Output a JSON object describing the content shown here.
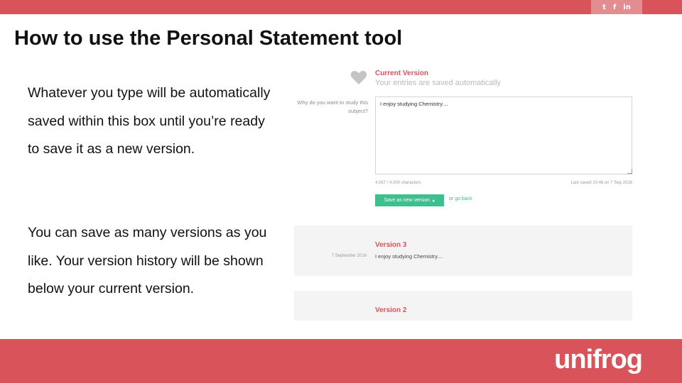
{
  "social_icons": [
    {
      "name": "twitter-icon",
      "glyph": "t"
    },
    {
      "name": "facebook-icon",
      "glyph": "f"
    },
    {
      "name": "linkedin-icon",
      "glyph": "in"
    }
  ],
  "slide": {
    "title": "How to use the Personal Statement tool",
    "description_1": "Whatever you type will be automatically saved within this box until you’re ready to save it as a new version.",
    "description_2": "You can save as many versions as you like. Your version history will be shown below your current version."
  },
  "tool": {
    "heart_icon": "heart-icon",
    "current_version_title": "Current Version",
    "current_version_subtitle": "Your entries are saved automatically",
    "question": "Why do you want to study this subject?",
    "entry_text": "I enjoy studying Chemistry....",
    "char_count": "4,067 / 4,000 characters",
    "last_saved": "Last saved 10:46 on 7 Sep 2016",
    "save_button": "Save as new version",
    "save_button_icon": "▸",
    "or_text": "or",
    "go_back": "go back",
    "versions": [
      {
        "title": "Version 3",
        "date": "7 September 2016",
        "text": "I enjoy studying Chemistry...."
      },
      {
        "title": "Version 2"
      }
    ]
  },
  "brand": {
    "logo": "unifrog",
    "accent_color": "#d9545a",
    "button_color": "#3dbf8f"
  }
}
